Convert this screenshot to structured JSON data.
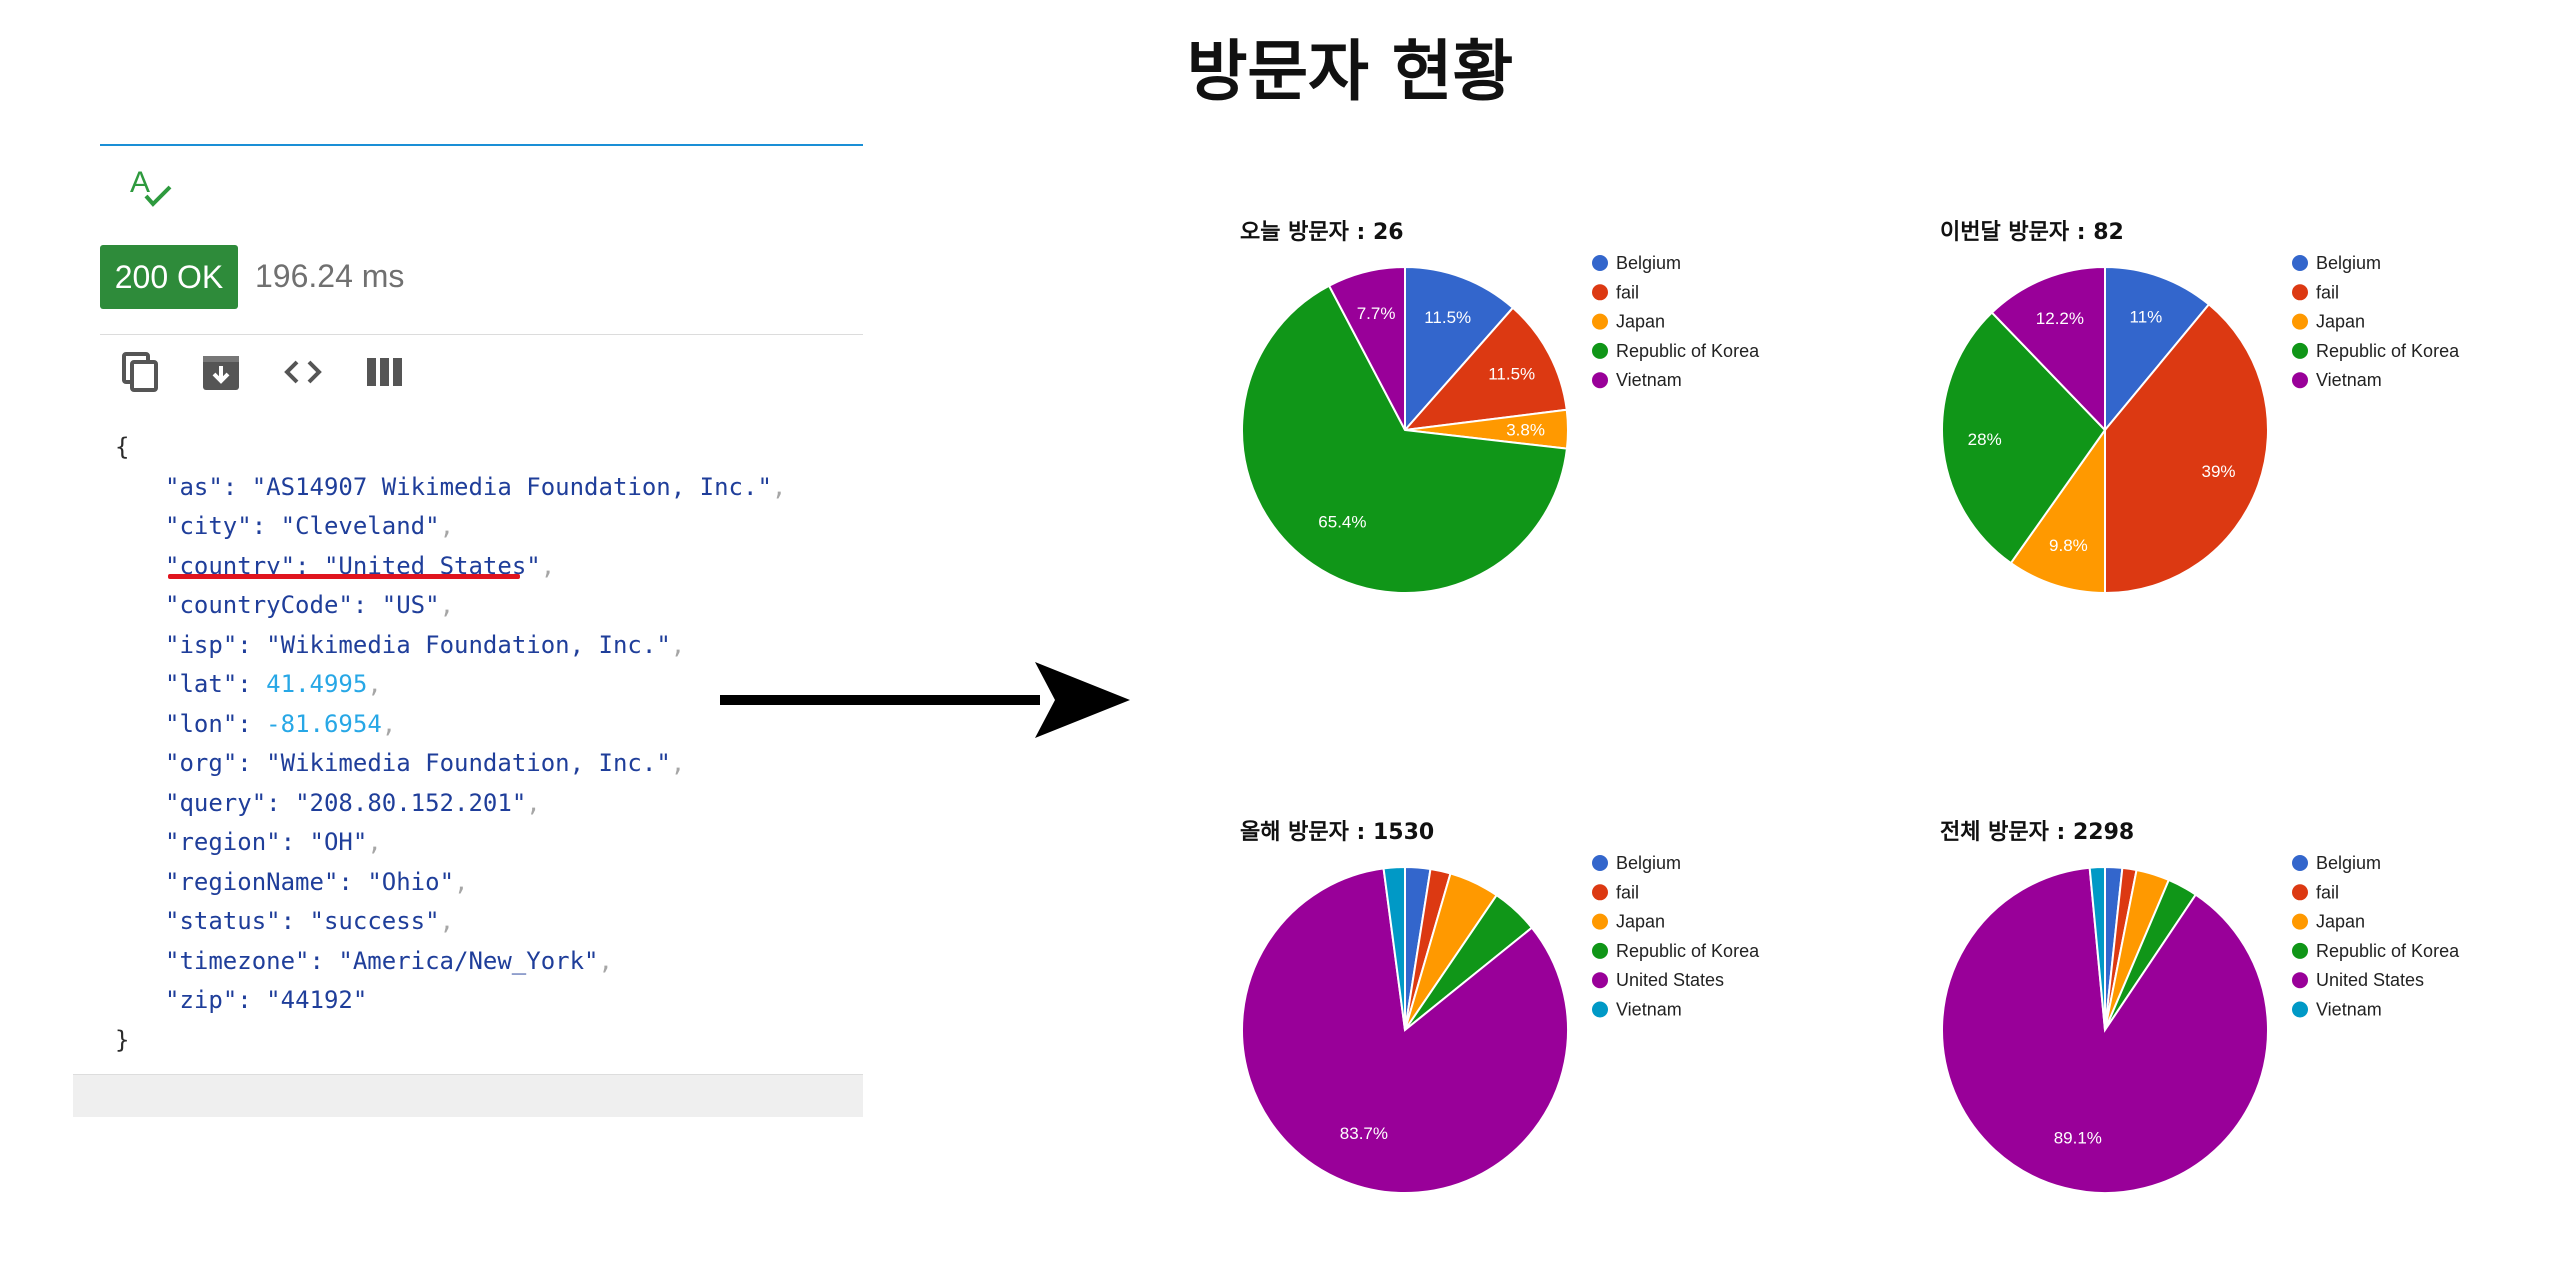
{
  "page": {
    "title": "방문자 현황"
  },
  "response": {
    "status": "200 OK",
    "time": "196.24 ms",
    "toolbar": [
      "copy-icon",
      "download-icon",
      "code-icon",
      "columns-icon"
    ],
    "json_open": "{",
    "json_close": "}",
    "fields": [
      {
        "key": "as",
        "value": "AS14907 Wikimedia Foundation, Inc.",
        "type": "string"
      },
      {
        "key": "city",
        "value": "Cleveland",
        "type": "string"
      },
      {
        "key": "country",
        "value": "United States",
        "type": "string"
      },
      {
        "key": "countryCode",
        "value": "US",
        "type": "string"
      },
      {
        "key": "isp",
        "value": "Wikimedia Foundation, Inc.",
        "type": "string"
      },
      {
        "key": "lat",
        "value": "41.4995",
        "type": "number"
      },
      {
        "key": "lon",
        "value": "-81.6954",
        "type": "number"
      },
      {
        "key": "org",
        "value": "Wikimedia Foundation, Inc.",
        "type": "string"
      },
      {
        "key": "query",
        "value": "208.80.152.201",
        "type": "string"
      },
      {
        "key": "region",
        "value": "OH",
        "type": "string"
      },
      {
        "key": "regionName",
        "value": "Ohio",
        "type": "string"
      },
      {
        "key": "status",
        "value": "success",
        "type": "string"
      },
      {
        "key": "timezone",
        "value": "America/New_York",
        "type": "string"
      },
      {
        "key": "zip",
        "value": "44192",
        "type": "string"
      }
    ]
  },
  "colors": {
    "Belgium": "#3366cc",
    "fail": "#dc3912",
    "Japan": "#ff9900",
    "Republic of Korea": "#109618",
    "United States": "#990099",
    "Vietnam": "#0099c6",
    "status_badge": "#2e8b3a",
    "accent_rule": "#1a8fd6",
    "underline": "#e0141e"
  },
  "chart_data": [
    {
      "type": "pie",
      "title": "오늘 방문자 : 26",
      "categories": [
        "Belgium",
        "fail",
        "Japan",
        "Republic of Korea",
        "Vietnam"
      ],
      "colors": [
        "#3366cc",
        "#dc3912",
        "#ff9900",
        "#109618",
        "#990099"
      ],
      "values": [
        11.5,
        11.5,
        3.8,
        65.4,
        7.7
      ],
      "labels": [
        "11.5%",
        "11.5%",
        "3.8%",
        "65.4%",
        "7.7%"
      ],
      "legend": "right"
    },
    {
      "type": "pie",
      "title": "이번달 방문자 : 82",
      "categories": [
        "Belgium",
        "fail",
        "Japan",
        "Republic of Korea",
        "Vietnam"
      ],
      "colors": [
        "#3366cc",
        "#dc3912",
        "#ff9900",
        "#109618",
        "#990099"
      ],
      "values": [
        11,
        39,
        9.8,
        28,
        12.2
      ],
      "labels": [
        "11%",
        "39%",
        "9.8%",
        "28%",
        "12.2%"
      ],
      "legend": "right"
    },
    {
      "type": "pie",
      "title": "올해 방문자 : 1530",
      "categories": [
        "Belgium",
        "fail",
        "Japan",
        "Republic of Korea",
        "United States",
        "Vietnam"
      ],
      "colors": [
        "#3366cc",
        "#dc3912",
        "#ff9900",
        "#109618",
        "#990099",
        "#0099c6"
      ],
      "values": [
        2.5,
        2.0,
        5.0,
        4.7,
        83.7,
        2.1
      ],
      "labels": [
        "",
        "",
        "",
        "",
        "83.7%",
        ""
      ],
      "legend": "right"
    },
    {
      "type": "pie",
      "title": "전체 방문자 : 2298",
      "categories": [
        "Belgium",
        "fail",
        "Japan",
        "Republic of Korea",
        "United States",
        "Vietnam"
      ],
      "colors": [
        "#3366cc",
        "#dc3912",
        "#ff9900",
        "#109618",
        "#990099",
        "#0099c6"
      ],
      "values": [
        1.7,
        1.4,
        3.3,
        3.0,
        89.1,
        1.5
      ],
      "labels": [
        "",
        "",
        "",
        "",
        "89.1%",
        ""
      ],
      "legend": "right"
    }
  ]
}
